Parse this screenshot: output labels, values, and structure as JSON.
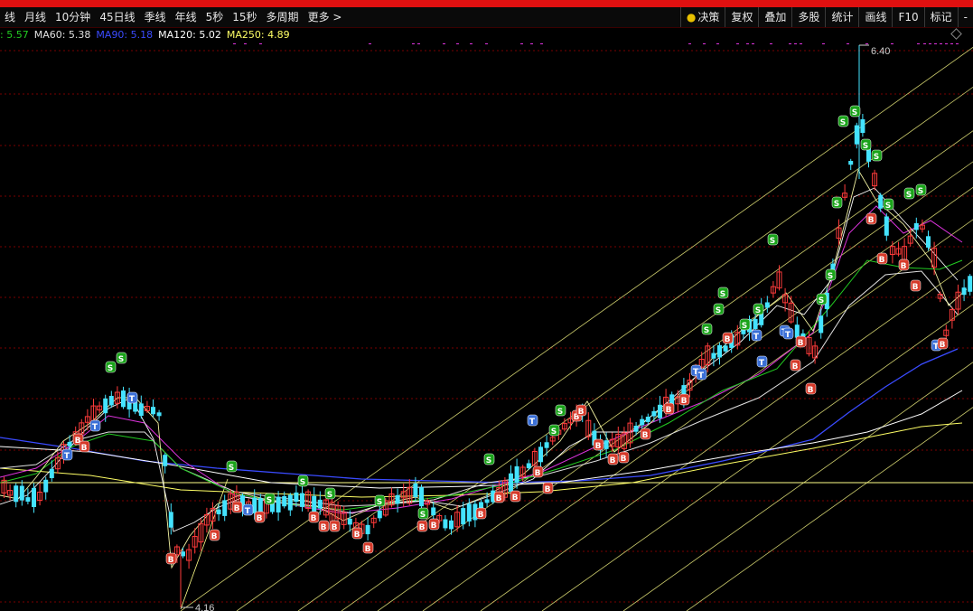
{
  "toolbar": {
    "items": [
      "线",
      "月线",
      "10分钟",
      "45日线",
      "季线",
      "年线",
      "5秒",
      "15秒",
      "多周期",
      "更多 >"
    ],
    "right": [
      "决策",
      "复权",
      "叠加",
      "多股",
      "统计",
      "画线",
      "F10",
      "标记",
      "-"
    ]
  },
  "ma": [
    {
      "label": ": 5.57",
      "color": "#22cc22"
    },
    {
      "label": "MA60: 5.38",
      "color": "#e0e0e0"
    },
    {
      "label": "MA90: 5.18",
      "color": "#3a4bff"
    },
    {
      "label": "MA120: 5.02",
      "color": "#ffffff"
    },
    {
      "label": "MA250: 4.89",
      "color": "#ffff66"
    }
  ],
  "chart_data": {
    "type": "candlestick",
    "high_label": "6.40",
    "low_label": "4.16",
    "ylim": [
      4.16,
      6.4
    ],
    "colors": {
      "up": "#ff3b3b",
      "down": "#44e3ff",
      "grid": "#7a0000",
      "hline": "#ffff88",
      "channel": "#ffff88",
      "signal_s": "#1aa31a",
      "signal_b": "#d63a2a",
      "signal_t": "#3a6fd6",
      "marker": "#dd33dd"
    }
  }
}
